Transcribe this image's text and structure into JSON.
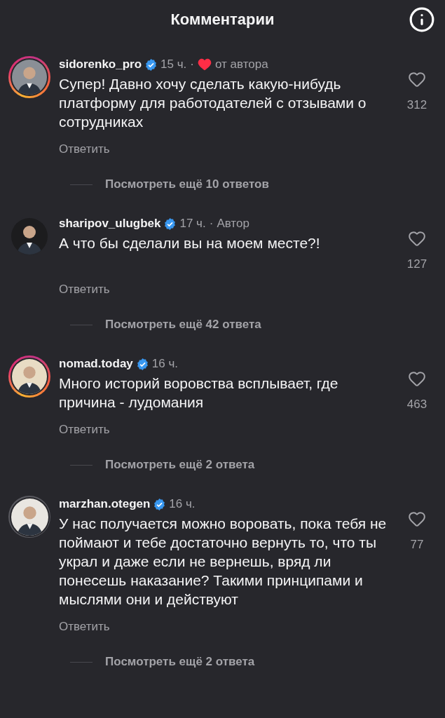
{
  "header": {
    "title": "Комментарии"
  },
  "comments": [
    {
      "username": "sidorenko_pro",
      "verified": true,
      "has_story": true,
      "story_seen": false,
      "time": "15 ч.",
      "badge": {
        "kind": "liked",
        "separator": "·",
        "label": "от автора"
      },
      "text": "Супер! Давно хочу сделать какую-нибудь платформу для работодателей с отзывами о сотрудниках",
      "likes": "312",
      "reply": "Ответить",
      "more_replies": "Посмотреть ещё 10 ответов"
    },
    {
      "username": "sharipov_ulugbek",
      "verified": true,
      "has_story": false,
      "time": "17 ч.",
      "badge": {
        "kind": "author",
        "separator": "·",
        "label": "Автор"
      },
      "text": "А что бы сделали вы на моем месте?!",
      "likes": "127",
      "reply": "Ответить",
      "more_replies": "Посмотреть ещё 42 ответа"
    },
    {
      "username": "nomad.today",
      "verified": true,
      "has_story": true,
      "story_seen": false,
      "time": "16 ч.",
      "text": "Много историй воровства всплывает, где причина - лудомания",
      "likes": "463",
      "reply": "Ответить",
      "more_replies": "Посмотреть ещё 2 ответа"
    },
    {
      "username": "marzhan.otegen",
      "verified": true,
      "has_story": true,
      "story_seen": true,
      "time": "16 ч.",
      "text": "У нас получается можно воровать, пока тебя не поймают и тебе достаточно вернуть то, что ты украл и даже если не вернешь, вряд ли понесешь наказание? Такими принципами и мыслями они и действуют",
      "likes": "77",
      "reply": "Ответить",
      "more_replies": "Посмотреть ещё 2 ответа"
    }
  ]
}
